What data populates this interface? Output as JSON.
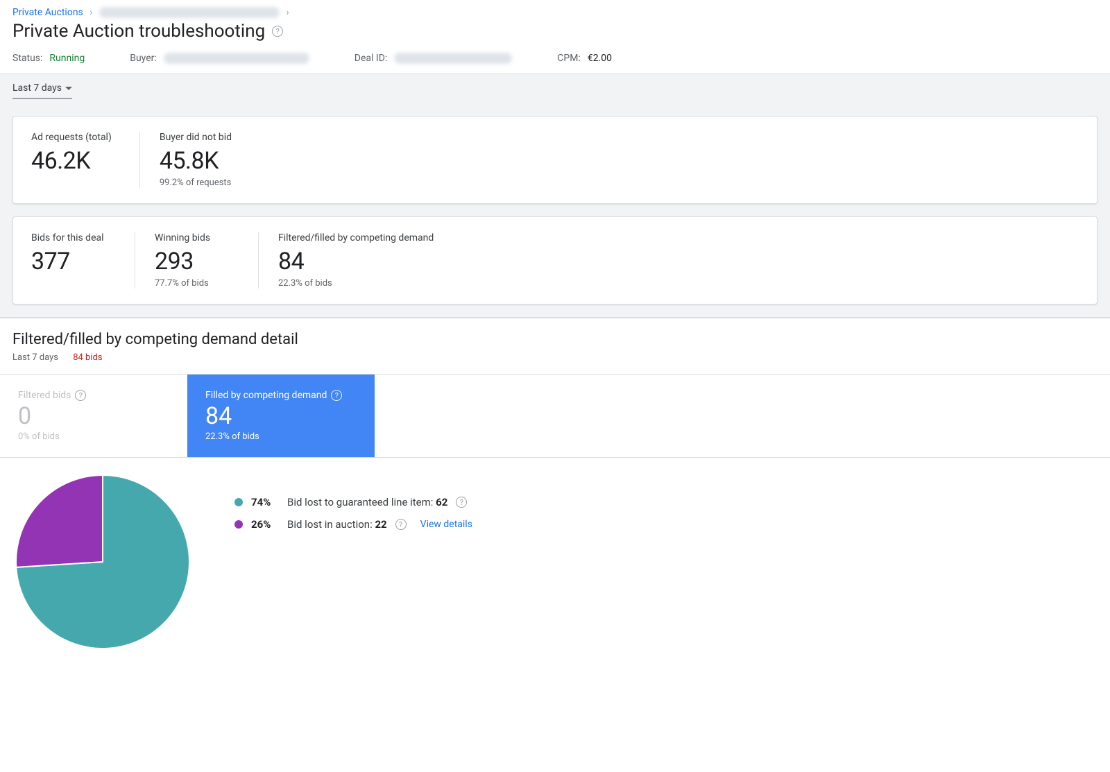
{
  "breadcrumb": {
    "root": "Private Auctions"
  },
  "title": "Private Auction troubleshooting",
  "status_row": {
    "status_label": "Status:",
    "status_value": "Running",
    "buyer_label": "Buyer:",
    "deal_label": "Deal ID:",
    "cpm_label": "CPM:",
    "cpm_value": "€2.00"
  },
  "date_range": "Last 7 days",
  "card1": {
    "ad_requests": {
      "label": "Ad requests (total)",
      "value": "46.2K"
    },
    "did_not_bid": {
      "label": "Buyer did not bid",
      "value": "45.8K",
      "sub": "99.2% of requests"
    }
  },
  "card2": {
    "bids": {
      "label": "Bids for this deal",
      "value": "377"
    },
    "winning": {
      "label": "Winning bids",
      "value": "293",
      "sub": "77.7% of bids"
    },
    "filtered": {
      "label": "Filtered/filled by competing demand",
      "value": "84",
      "sub": "22.3% of bids"
    }
  },
  "detail": {
    "heading": "Filtered/filled by competing demand detail",
    "sub_period": "Last 7 days",
    "sub_count": "84 bids"
  },
  "tiles": {
    "filtered": {
      "label": "Filtered bids",
      "value": "0",
      "sub": "0% of bids"
    },
    "competing": {
      "label": "Filled by competing demand",
      "value": "84",
      "sub": "22.3% of bids"
    }
  },
  "chart_data": {
    "type": "pie",
    "title": "Filled by competing demand",
    "series": [
      {
        "name": "Bid lost to guaranteed line item",
        "value": 62,
        "percent": 74,
        "color": "#45a8ad"
      },
      {
        "name": "Bid lost in auction",
        "value": 22,
        "percent": 26,
        "color": "#9334b4"
      }
    ]
  },
  "legend": {
    "item1_pct": "74%",
    "item1_text": "Bid lost to guaranteed line item: ",
    "item1_val": "62",
    "item2_pct": "26%",
    "item2_text": "Bid lost in auction: ",
    "item2_val": "22",
    "view_details": "View details"
  }
}
